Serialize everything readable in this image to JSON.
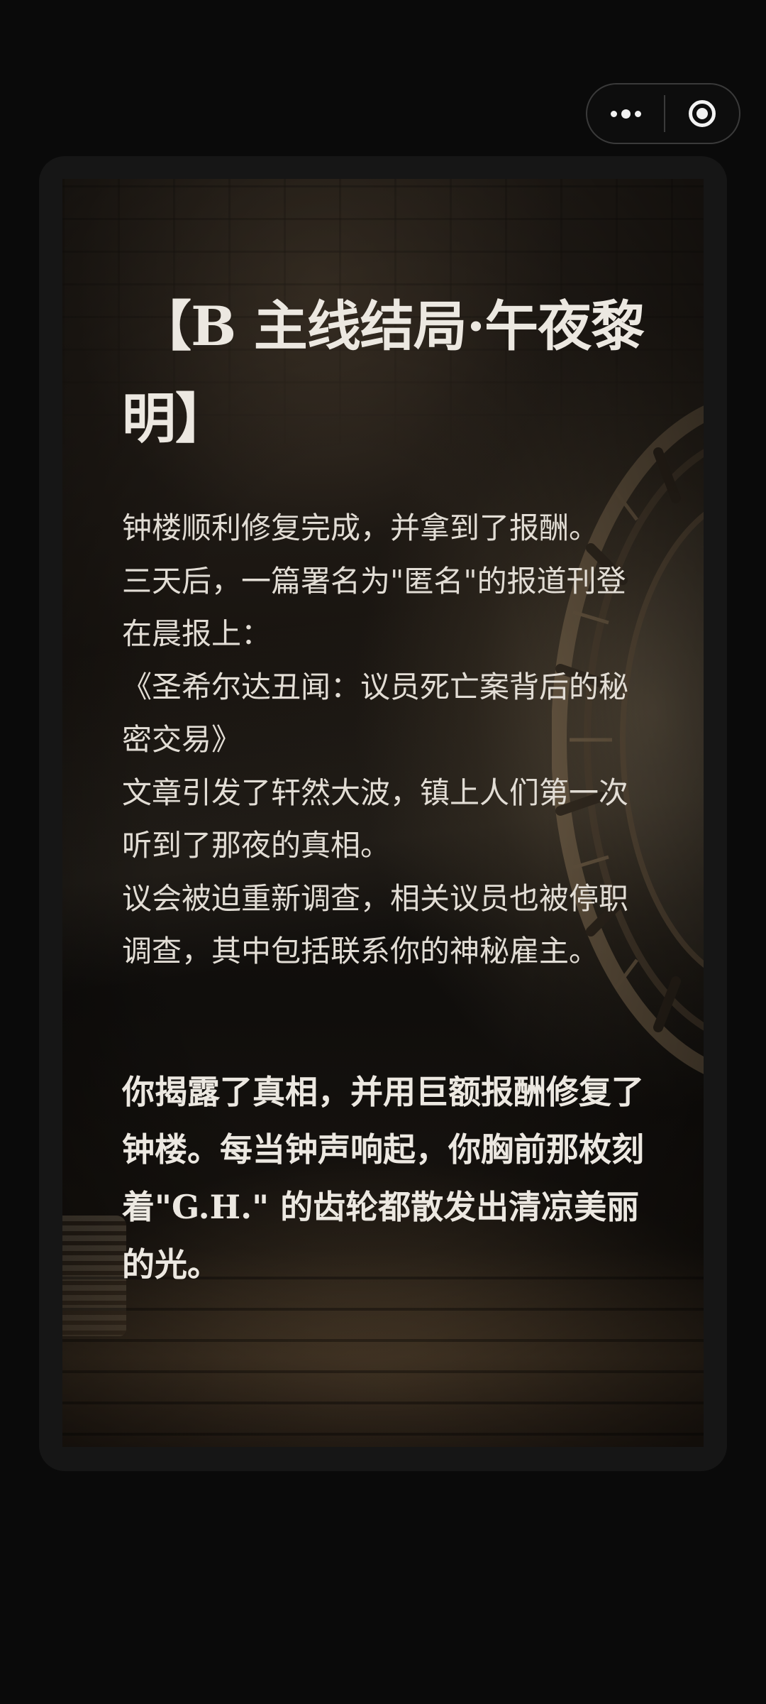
{
  "capsule": {
    "more_icon": "more-dots-icon",
    "close_icon": "target-circle-icon"
  },
  "story": {
    "title": "【B 主线结局·午夜黎明】",
    "paragraphs": [
      "钟楼顺利修复完成，并拿到了报酬。",
      "三天后，一篇署名为\"匿名\"的报道刊登在晨报上：",
      "《圣希尔达丑闻：议员死亡案背后的秘密交易》",
      "文章引发了轩然大波，镇上人们第一次听到了那夜的真相。",
      "议会被迫重新调查，相关议员也被停职调查，其中包括联系你的神秘雇主。"
    ],
    "ending": "你揭露了真相，并用巨额报酬修复了钟楼。每当钟声响起，你胸前那枚刻着\"G.H.\" 的齿轮都散发出清凉美丽的光。"
  },
  "colors": {
    "background": "#0a0a0a",
    "card_frame": "#161616",
    "text": "#e7e3dc"
  }
}
